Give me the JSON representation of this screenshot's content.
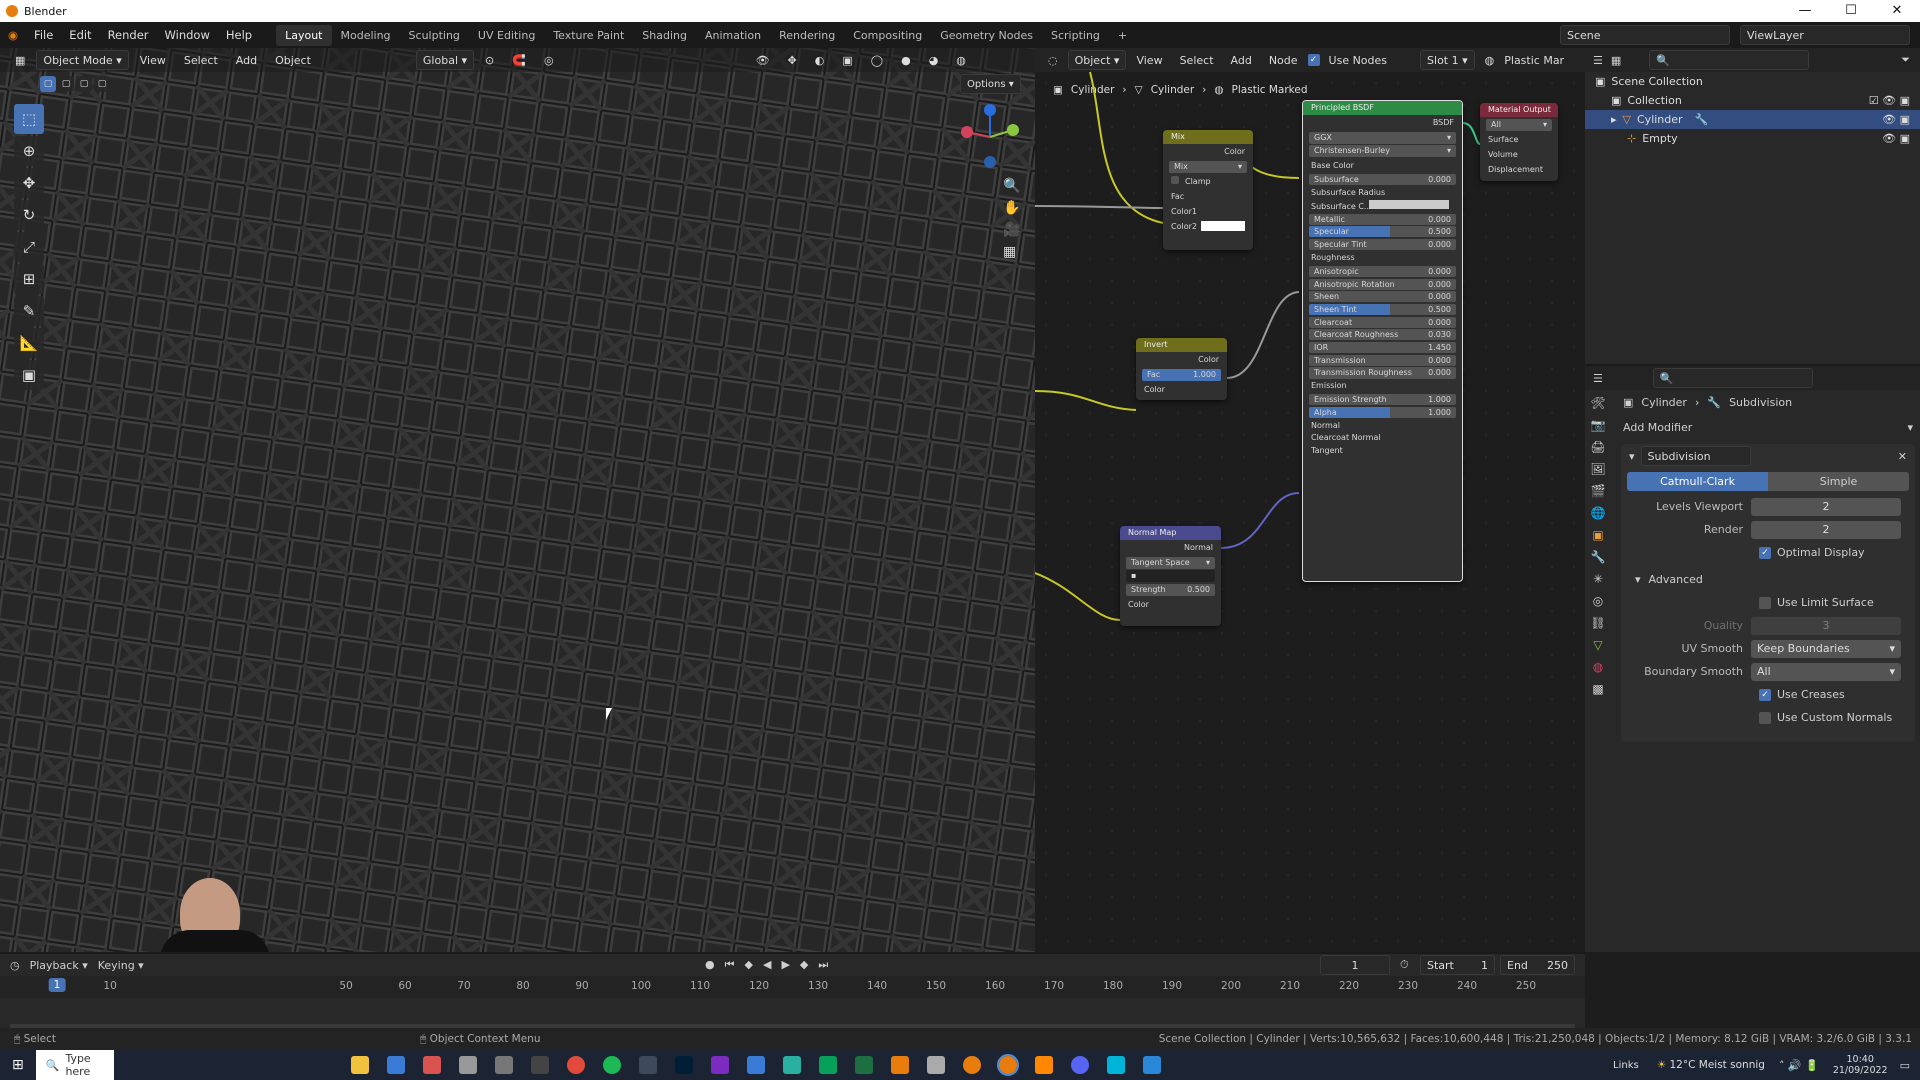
{
  "app": {
    "title": "Blender",
    "win_controls": [
      "—",
      "☐",
      "✕"
    ]
  },
  "menu": {
    "items": [
      "File",
      "Edit",
      "Render",
      "Window",
      "Help"
    ],
    "workspaces": [
      "Layout",
      "Modeling",
      "Sculpting",
      "UV Editing",
      "Texture Paint",
      "Shading",
      "Animation",
      "Rendering",
      "Compositing",
      "Geometry Nodes",
      "Scripting"
    ],
    "add_tab": "+",
    "scene": "Scene",
    "view_layer": "ViewLayer"
  },
  "viewport": {
    "mode": "Object Mode",
    "menus": [
      "View",
      "Select",
      "Add",
      "Object"
    ],
    "transform": "Global",
    "options": "Options"
  },
  "nodes": {
    "header_mode": "Object",
    "menus": [
      "View",
      "Select",
      "Add",
      "Node"
    ],
    "use_nodes": "Use Nodes",
    "slot": "Slot 1",
    "material": "Plastic Mar",
    "breadcrumb": [
      "Cylinder",
      "Cylinder",
      "Plastic Marked"
    ],
    "mix": {
      "title": "Mix",
      "out": "Color",
      "mode": "Mix",
      "clamp": "Clamp",
      "fac": "Fac",
      "c1": "Color1",
      "c2": "Color2"
    },
    "invert": {
      "title": "Invert",
      "out": "Color",
      "fac_label": "Fac",
      "fac_val": "1.000",
      "in": "Color"
    },
    "normalmap": {
      "title": "Normal Map",
      "out": "Normal",
      "space": "Tangent Space",
      "strength_label": "Strength",
      "strength_val": "0.500",
      "in": "Color"
    },
    "bsdf": {
      "title": "Principled BSDF",
      "out": "BSDF",
      "dist": "GGX",
      "sss": "Christensen-Burley",
      "base": "Base Color",
      "rows": [
        [
          "Subsurface",
          "0.000"
        ],
        [
          "Subsurface Radius",
          ""
        ],
        [
          "Subsurface C..",
          ""
        ],
        [
          "Metallic",
          "0.000"
        ],
        [
          "Specular",
          "0.500"
        ],
        [
          "Specular Tint",
          "0.000"
        ],
        [
          "Roughness",
          ""
        ],
        [
          "Anisotropic",
          "0.000"
        ],
        [
          "Anisotropic Rotation",
          "0.000"
        ],
        [
          "Sheen",
          "0.000"
        ],
        [
          "Sheen Tint",
          "0.500"
        ],
        [
          "Clearcoat",
          "0.000"
        ],
        [
          "Clearcoat Roughness",
          "0.030"
        ],
        [
          "IOR",
          "1.450"
        ],
        [
          "Transmission",
          "0.000"
        ],
        [
          "Transmission Roughness",
          "0.000"
        ],
        [
          "Emission",
          ""
        ],
        [
          "Emission Strength",
          "1.000"
        ],
        [
          "Alpha",
          "1.000"
        ],
        [
          "Normal",
          ""
        ],
        [
          "Clearcoat Normal",
          ""
        ],
        [
          "Tangent",
          ""
        ]
      ]
    },
    "output": {
      "title": "Material Output",
      "target": "All",
      "surface": "Surface",
      "volume": "Volume",
      "disp": "Displacement"
    }
  },
  "outliner": {
    "root": "Scene Collection",
    "collection": "Collection",
    "items": [
      "Cylinder",
      "Empty"
    ]
  },
  "props": {
    "object": "Cylinder",
    "modifier_crumb": "Subdivision",
    "add_modifier": "Add Modifier",
    "mod_name": "Subdivision",
    "tab_a": "Catmull-Clark",
    "tab_b": "Simple",
    "levels_label": "Levels Viewport",
    "levels": "2",
    "render_label": "Render",
    "render": "2",
    "optimal": "Optimal Display",
    "advanced": "Advanced",
    "limit": "Use Limit Surface",
    "quality_label": "Quality",
    "quality": "3",
    "uv_label": "UV Smooth",
    "uv": "Keep Boundaries",
    "bound_label": "Boundary Smooth",
    "bound": "All",
    "creases": "Use Creases",
    "custom": "Use Custom Normals"
  },
  "timeline": {
    "playback": "Playback",
    "keying": "Keying",
    "frame": "1",
    "start_label": "Start",
    "start": "1",
    "end_label": "End",
    "end": "250",
    "ticks": [
      "1",
      "10",
      "50",
      "60",
      "70",
      "80",
      "90",
      "100",
      "110",
      "120",
      "130",
      "140",
      "150",
      "160",
      "170",
      "180",
      "190",
      "200",
      "210",
      "220",
      "230",
      "240",
      "250"
    ]
  },
  "status": {
    "left": "Select",
    "mid": "Object Context Menu",
    "right": "Scene Collection | Cylinder | Verts:10,565,632 | Faces:10,600,448 | Tris:21,250,048 | Objects:1/2 | Memory: 8.12 GiB | VRAM: 3.2/6.0 GiB | 3.3.1"
  },
  "taskbar": {
    "search": "Type here",
    "links": "Links",
    "weather": "12°C Meist sonnig",
    "time": "10:40",
    "date": "21/09/2022"
  }
}
